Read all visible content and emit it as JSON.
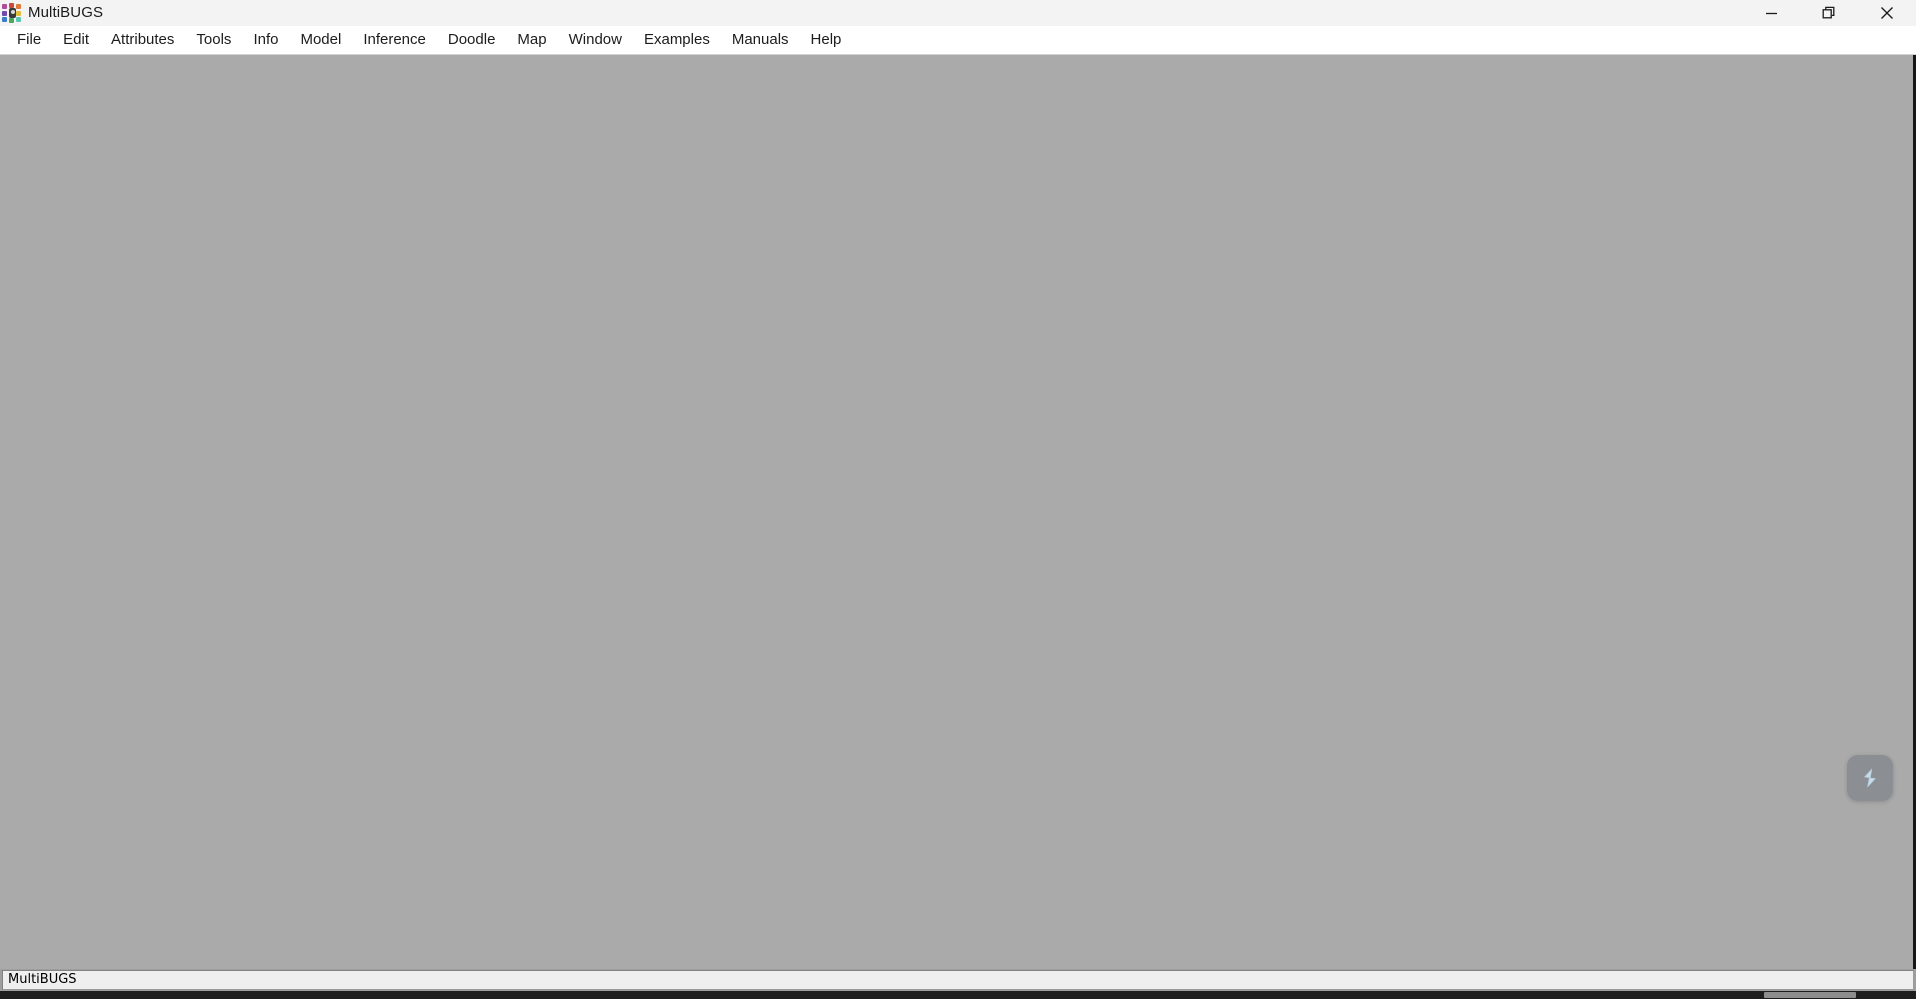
{
  "window": {
    "title": "MultiBUGS",
    "icon": "multibugs-graph-icon",
    "controls": {
      "minimize_label": "Minimize",
      "restore_label": "Restore",
      "close_label": "Close"
    }
  },
  "menu": {
    "items": [
      {
        "label": "File"
      },
      {
        "label": "Edit"
      },
      {
        "label": "Attributes"
      },
      {
        "label": "Tools"
      },
      {
        "label": "Info"
      },
      {
        "label": "Model"
      },
      {
        "label": "Inference"
      },
      {
        "label": "Doodle"
      },
      {
        "label": "Map"
      },
      {
        "label": "Window"
      },
      {
        "label": "Examples"
      },
      {
        "label": "Manuals"
      },
      {
        "label": "Help"
      }
    ]
  },
  "workspace": {
    "background_color": "#aaaaaa",
    "content": ""
  },
  "float_widget": {
    "icon": "lightning-bolt-icon",
    "background_color": "#787d82",
    "glyph_color": "#c5d9e8"
  },
  "status_bar": {
    "text": "MultiBUGS"
  },
  "colors": {
    "title_bar": "#f3f3f3",
    "menu_bar": "#ffffff",
    "workspace": "#aaaaaa",
    "status_bar_frame": "#9e9e9e",
    "status_bar_field": "#efefef",
    "text": "#1c1c1c"
  }
}
